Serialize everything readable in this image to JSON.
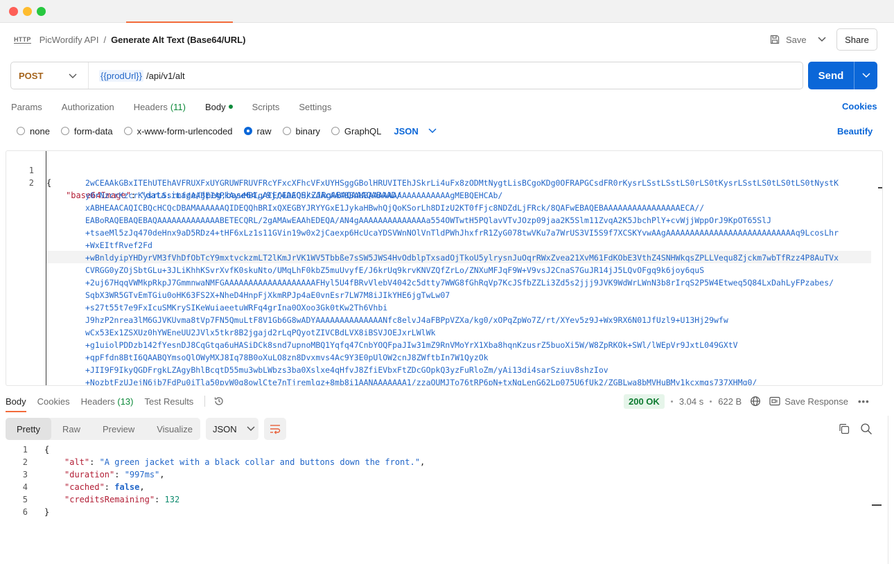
{
  "breadcrumb": {
    "badge": "HTTP",
    "collection": "PicWordify API",
    "separator": "/",
    "request": "Generate Alt Text (Base64/URL)"
  },
  "header_actions": {
    "save": "Save",
    "share": "Share"
  },
  "request": {
    "method": "POST",
    "url_variable": "{{prodUrl}}",
    "url_path": "/api/v1/alt",
    "send": "Send"
  },
  "request_tabs": {
    "params": "Params",
    "authorization": "Authorization",
    "headers": "Headers",
    "headers_count": "(11)",
    "body": "Body",
    "scripts": "Scripts",
    "settings": "Settings",
    "cookies": "Cookies"
  },
  "body_types": {
    "none": "none",
    "form_data": "form-data",
    "urlencoded": "x-www-form-urlencoded",
    "raw": "raw",
    "binary": "binary",
    "graphql": "GraphQL",
    "format": "JSON",
    "beautify": "Beautify"
  },
  "request_body": {
    "line1_no": "1",
    "line1": "{",
    "line2_no": "2",
    "key": "\"base64Image\"",
    "colon": ": ",
    "value_start": "\"data:image/jpeg;base64,/9j/4AAQSkZJRgABAQAAAQABAAD/",
    "continuation": [
      "2wCEAAkGBxITEhUTEhAVFRUXFxUYGRUWFRUVFRcYFxcXFhcVFxUYHSggGBolHRUVITEhJSkrLi4uFx8zODMtNygtLisBCgoKDg0OFRAPGCsdFR0rKysrLSstLSstLS0rLS0tKysrLSstLS0tLS0tLS0tNystK",
      "y0rNzcrKzcrKysrLSsrLf/AABEIAPkAywMBIgACEQEDEQH/xAAcAAABBAMBAAAAAAAAAAAAAAAAAgMEBQEHCAb/",
      "xABHEAACAQICBQcHCQcDBAMAAAAAAQIDEQQhBRIxQXEGBYJRYYGxE1JykaHBwhQjQoKSorLh8DIzU2KT0fFjc8NDZdLjFRck/8QAFwEBAQEBAAAAAAAAAAAAAAAAECA//",
      "EABoRAQEBAQEBAQAAAAAAAAAAAAABETECQRL/2gAMAwEAAhEDEQA/AN4gAAAAAAAAAAAAAAa554OWTwtH5PQlavVTvJOzp09jaa2K5Slm11ZvqA2K5JbchPlY+cvWjjWppOrJ9KpOT65SlJ",
      "+tsaeMl5zJq470deHnx9aD5RDz4+tHF6xLz1s11GVin19w0x2jCaexp6HcUcaYDSVWnNOlVnTldPWhJhxfrR1ZyG078twVKu7a7WrUS3VI5S9f7XCSKYvwAAgAAAAAAAAAAAAAAAAAAAAAAAAAAAq9LcosLhr",
      "+WxEItfRvef2Fd",
      "+wBnldyipYHDyrVM3fVhDfObTcY9mxtvckzmLT2lKmJrVK1WV5Tbbße7sSW5JWS4HvOdblpTxsadOjTkoU5ylrysnJuOqrRWxZvea21XvM61FdKObE3VthZ4SNHWkqsZPLLVequ8Zjckm7wbTfRzz4P8AuTVx",
      "CVRGG0yZOjSbtGLu+3JLiKhhKSvrXvfK0skuNto/UMqLhF0kbZ5muUvyfE/J6krUq9krvKNVZQfZrLo/ZNXuMFJqF9W+V9vsJ2CnaS7GuJR14jJ5LQvOFgq9k6joy6quS",
      "+2uj67HqqVWMkpRkpJ7GmmnwaNMFGAAAAAAAAAAAAAAAAAAAFHyl5U4fBRvVlebV4042c5dtty7WWG8fGhRqVp7KcJSfbZZLi3Zd5s2jjj9JVK9WdWrLWnN3b8rIrqS2P5W4Etweq5Q84LxDahLyFPzabes/",
      "SqbX3WR5GTvEmTGiu0oHK63FS2X+NheD4HnpFjXkmRPJp4aE0vnEsr7LW7M8iJIkYHE6jgTwLw07",
      "+s27t55t7e9FxIcuSMKrySIKeWuiaeetuWRFq4grIna0OXoo3Gk0tKw2Th6Vhbi",
      "J9hzP2nrea3lM6GJVKUvma8tVp7FN5QmuLtF8V1Gb6G8wADYAAAAAAAAAAAAAANfc8elvJ4aFBPpVZXa/kg0/xOPqZpWo7Z/rt/XYev5z9J+Wx9RX6N01JfUzl9+U13Hj29wfw",
      "wCx53Ex1ZSXUz0hYWEneUU2JVlx5tkr8B2jgajd2rLqPQyotZIVCBdLVX8iBSVJOEJxrLWlWk",
      "+g1uiolPDDzb142fYesnDJ8CqGtqa6uHASiDCk8snd7upnoMBQ1Yqfq47CnbYOQFpaJIw31mZ9RnVMoYrX1Xba8hqnKzusrZ5buoXi5W/W8ZpRKOk+SWl/lWEpVr9JxtL049GXtV",
      "+qpFfdn8BtI6QAABQYmsoQlOWyMXJ8Iq78B0oXuLO8zn8Dvxmvs4Ac9Y3E0pUlOW2cnJ8ZWftbIn7W1QyzOk",
      "+JII9F9IkyQGDFrgkLZAgyBhlBcqtD55mu3wbLWbzs3ba0Xslxe4qHfvJ8ZfiEVbxFtZDcGOpkQ3yzFuRloZm/yAi13di4sarSziuv8shzIov",
      "+NozbtFzUJejN6jb7FdPu0iTla50pvW0g8owlCte7nTjremlgz+8mb8i1AANAAAAAAA1/zzaQUMJTo76tRP6pN+txNgLenG62Lp075U6fUk2/ZGBLwa8bMVHuBMy1kcxmgs737XHMq0/"
    ]
  },
  "response_tabs": {
    "body": "Body",
    "cookies": "Cookies",
    "headers": "Headers",
    "headers_count": "(13)",
    "test_results": "Test Results"
  },
  "response_meta": {
    "status": "200 OK",
    "time": "3.04 s",
    "size": "622 B",
    "save_response": "Save Response"
  },
  "response_views": {
    "pretty": "Pretty",
    "raw": "Raw",
    "preview": "Preview",
    "visualize": "Visualize",
    "format": "JSON"
  },
  "response_body": {
    "lines": [
      {
        "no": "1",
        "text": "{"
      },
      {
        "no": "2",
        "key": "\"alt\"",
        "value": "\"A green jacket with a black collar and buttons down the front.\"",
        "trail": ","
      },
      {
        "no": "3",
        "key": "\"duration\"",
        "value": "\"997ms\"",
        "trail": ","
      },
      {
        "no": "4",
        "key": "\"cached\"",
        "value": "false",
        "trail": ","
      },
      {
        "no": "5",
        "key": "\"creditsRemaining\"",
        "value": "132",
        "trail": ""
      },
      {
        "no": "6",
        "text": "}"
      }
    ]
  },
  "colors": {
    "accent": "#0b67d8",
    "method": "#a5641c",
    "tab_underline": "#f26b3a",
    "status_ok": "#0d7a30",
    "json_key": "#b21e35",
    "json_string": "#2367c9"
  }
}
